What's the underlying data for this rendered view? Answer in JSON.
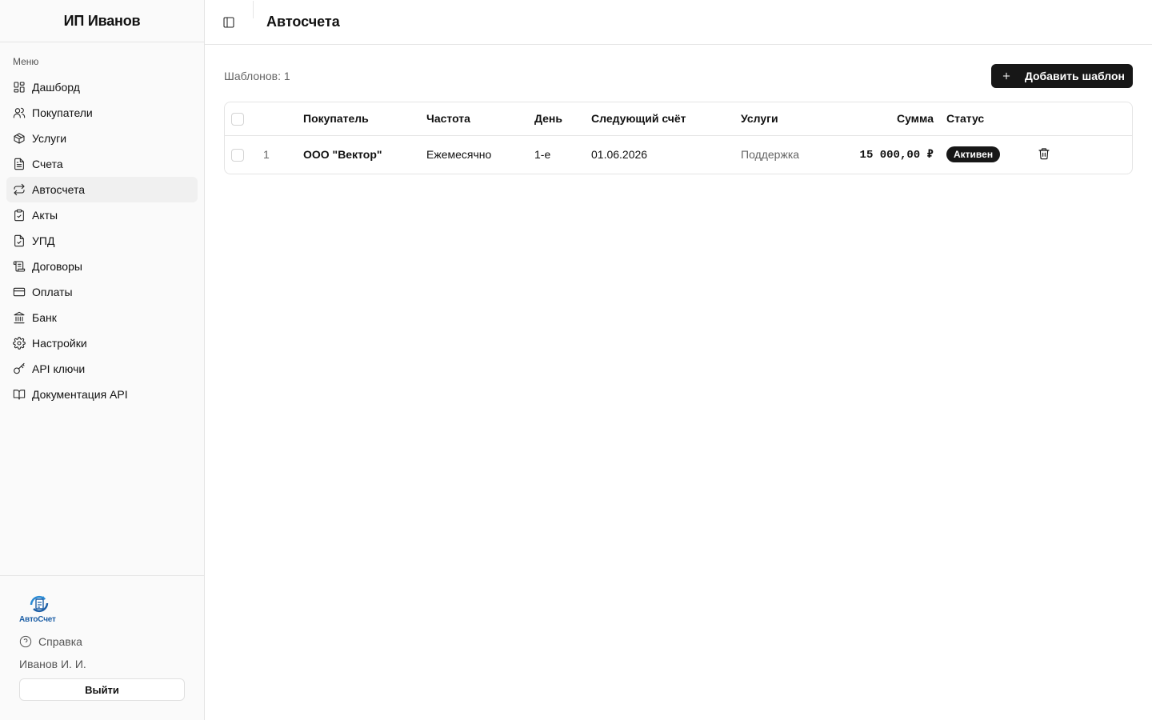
{
  "sidebar": {
    "org_name": "ИП Иванов",
    "group_label": "Меню",
    "items": [
      {
        "label": "Дашборд",
        "icon": "dashboard-icon"
      },
      {
        "label": "Покупатели",
        "icon": "users-icon"
      },
      {
        "label": "Услуги",
        "icon": "package-icon"
      },
      {
        "label": "Счета",
        "icon": "file-text-icon"
      },
      {
        "label": "Автосчета",
        "icon": "repeat-icon",
        "active": true
      },
      {
        "label": "Акты",
        "icon": "clipboard-check-icon"
      },
      {
        "label": "УПД",
        "icon": "file-check-icon"
      },
      {
        "label": "Договоры",
        "icon": "scroll-icon"
      },
      {
        "label": "Оплаты",
        "icon": "credit-card-icon"
      },
      {
        "label": "Банк",
        "icon": "bank-icon"
      },
      {
        "label": "Настройки",
        "icon": "gear-icon"
      },
      {
        "label": "API ключи",
        "icon": "key-icon"
      },
      {
        "label": "Документация API",
        "icon": "book-icon"
      }
    ],
    "footer": {
      "logo_text": "АвтоСчет",
      "help_label": "Справка",
      "user_name": "Иванов И. И.",
      "logout_label": "Выйти"
    }
  },
  "header": {
    "title": "Автосчета"
  },
  "toolbar": {
    "count_label": "Шаблонов: 1",
    "add_label": "Добавить шаблон"
  },
  "table": {
    "columns": {
      "buyer": "Покупатель",
      "frequency": "Частота",
      "day": "День",
      "next_invoice": "Следующий счёт",
      "services": "Услуги",
      "sum": "Сумма",
      "status": "Статус"
    },
    "rows": [
      {
        "num": "1",
        "buyer": "ООО \"Вектор\"",
        "frequency": "Ежемесячно",
        "day": "1-е",
        "next_invoice": "01.06.2026",
        "services": "Поддержка",
        "sum": "15 000,00 ₽",
        "status": "Активен"
      }
    ]
  },
  "colors": {
    "accent": "#171717",
    "sidebar_bg": "#fafafa",
    "border": "#e5e5e5",
    "logo_blue": "#1d5fa6"
  }
}
